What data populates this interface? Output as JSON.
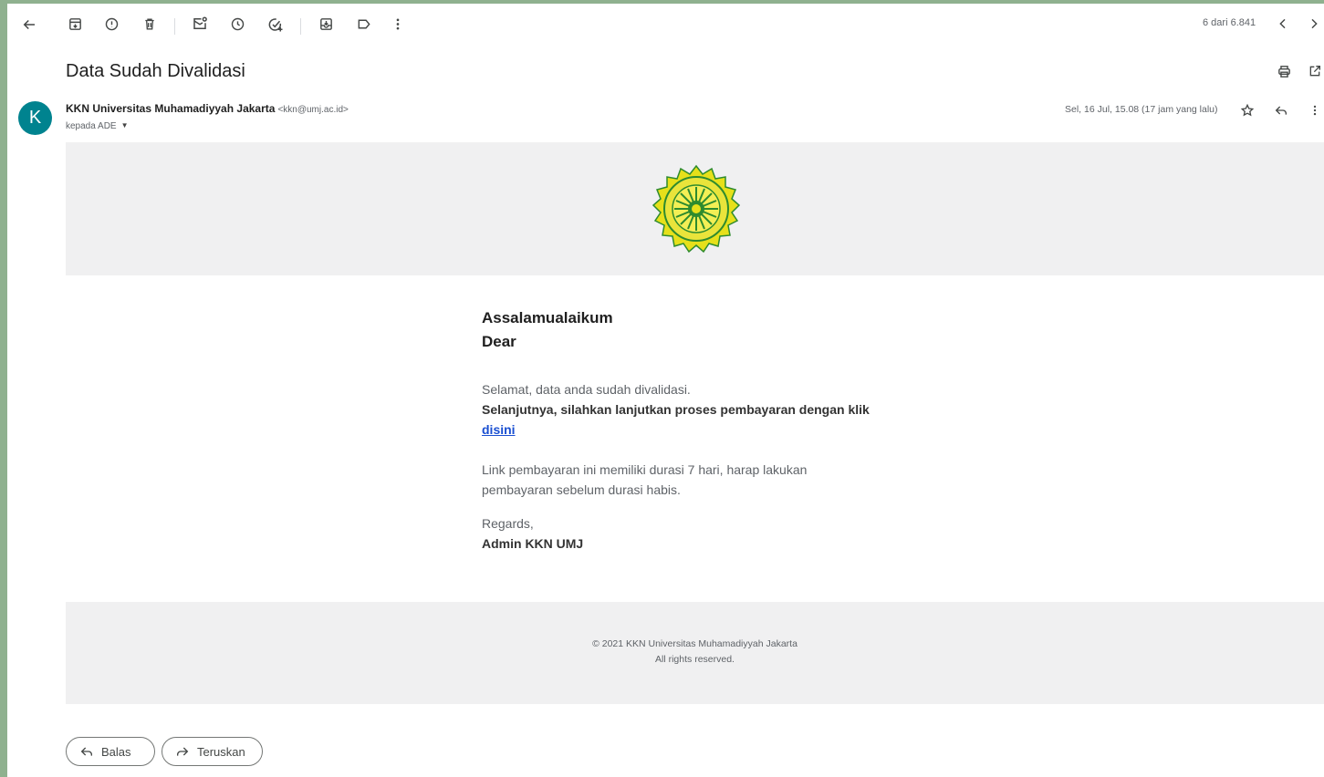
{
  "toolbar": {
    "icons": [
      "back-arrow-icon",
      "archive-icon",
      "report-spam-icon",
      "delete-icon",
      "mark-unread-icon",
      "snooze-icon",
      "add-task-icon",
      "move-to-icon",
      "label-icon",
      "more-vert-icon"
    ],
    "pager": "6 dari 6.841"
  },
  "email": {
    "subject": "Data Sudah Divalidasi",
    "sender_initial": "K",
    "sender_name": "KKN Universitas Muhamadiyyah Jakarta",
    "sender_address": "<kkn@umj.ac.id>",
    "to_label": "kepada ADE",
    "date": "Sel, 16 Jul, 15.08 (17 jam yang lalu)"
  },
  "body": {
    "greeting": "Assalamualaikum",
    "dear": "Dear",
    "line1": "Selamat, data anda sudah divalidasi.",
    "line2": "Selanjutnya, silahkan lanjutkan proses pembayaran dengan klik",
    "link": "disini",
    "line3": "Link pembayaran ini memiliki durasi 7 hari, harap lakukan",
    "line4": "pembayaran sebelum durasi habis.",
    "regards": "Regards,",
    "signature": "Admin KKN UMJ"
  },
  "footer": {
    "copyright": "© 2021 KKN Universitas Muhamadiyyah Jakarta",
    "rights": "All rights reserved."
  },
  "actions": {
    "reply": "Balas",
    "forward": "Teruskan"
  },
  "colors": {
    "avatar": "#00838f",
    "link": "#1a4fd1",
    "seal_yellow": "#e6e01a",
    "seal_green": "#2e8b2e",
    "outer_background": "#8fb18f"
  }
}
